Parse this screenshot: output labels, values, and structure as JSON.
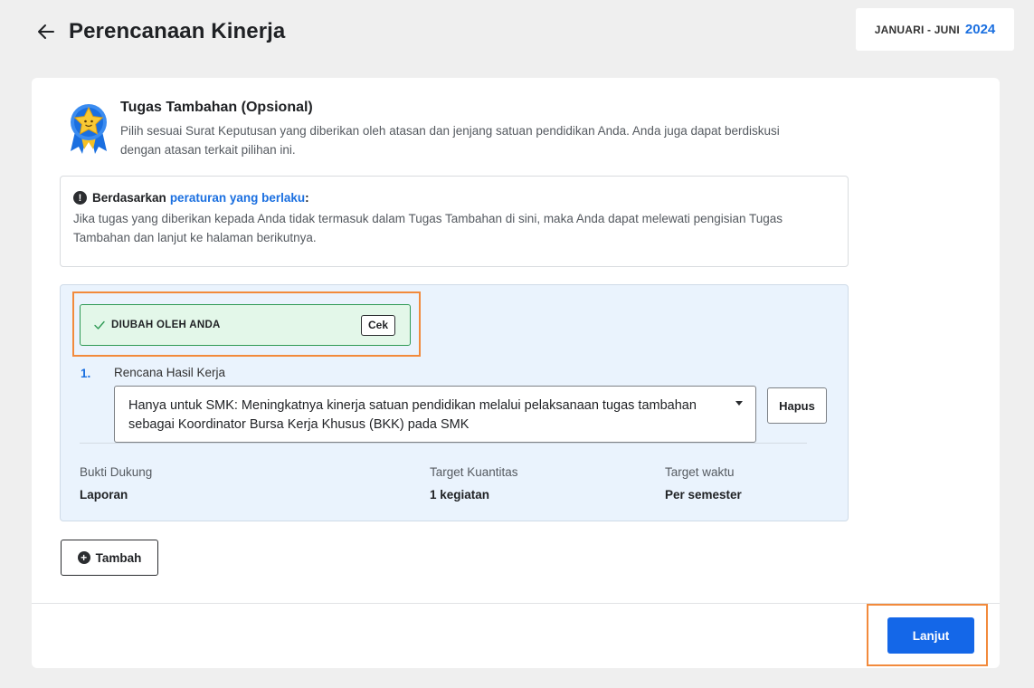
{
  "header": {
    "title": "Perencanaan Kinerja",
    "period_label": "JANUARI - JUNI",
    "period_year": "2024"
  },
  "intro": {
    "title": "Tugas Tambahan (Opsional)",
    "description": "Pilih sesuai Surat Keputusan yang diberikan oleh atasan dan jenjang satuan pendidikan Anda. Anda juga dapat berdiskusi dengan atasan terkait pilihan ini."
  },
  "info": {
    "prefix": "Berdasarkan",
    "link": "peraturan yang berlaku",
    "suffix": ":",
    "body": "Jika tugas yang diberikan kepada Anda tidak termasuk dalam Tugas Tambahan di sini, maka Anda dapat melewati pengisian Tugas Tambahan dan lanjut ke halaman berikutnya."
  },
  "task": {
    "status": "DIUBAH OLEH ANDA",
    "check_label": "Cek",
    "number": "1.",
    "rhk_label": "Rencana Hasil Kerja",
    "rhk_value": "Hanya untuk SMK: Meningkatnya kinerja satuan pendidikan melalui pelaksanaan tugas tambahan sebagai Koordinator Bursa Kerja Khusus (BKK) pada SMK",
    "delete_label": "Hapus",
    "evidence_label": "Bukti Dukung",
    "evidence_value": "Laporan",
    "quantity_label": "Target Kuantitas",
    "quantity_value": "1 kegiatan",
    "time_label": "Target waktu",
    "time_value": "Per semester"
  },
  "actions": {
    "add_label": "Tambah",
    "next_label": "Lanjut"
  },
  "colors": {
    "accent": "#1467e8",
    "link": "#1a6fe0",
    "highlight": "#f28a3c",
    "status_bg": "#e3f7e9",
    "status_border": "#2f9a55",
    "task_bg": "#eaf3fd"
  },
  "icons": {
    "back": "arrow-left-icon",
    "medal": "star-medal-icon",
    "alert": "exclamation-circle-icon",
    "check": "check-icon",
    "caret": "caret-down-icon",
    "plus": "plus-circle-icon"
  }
}
